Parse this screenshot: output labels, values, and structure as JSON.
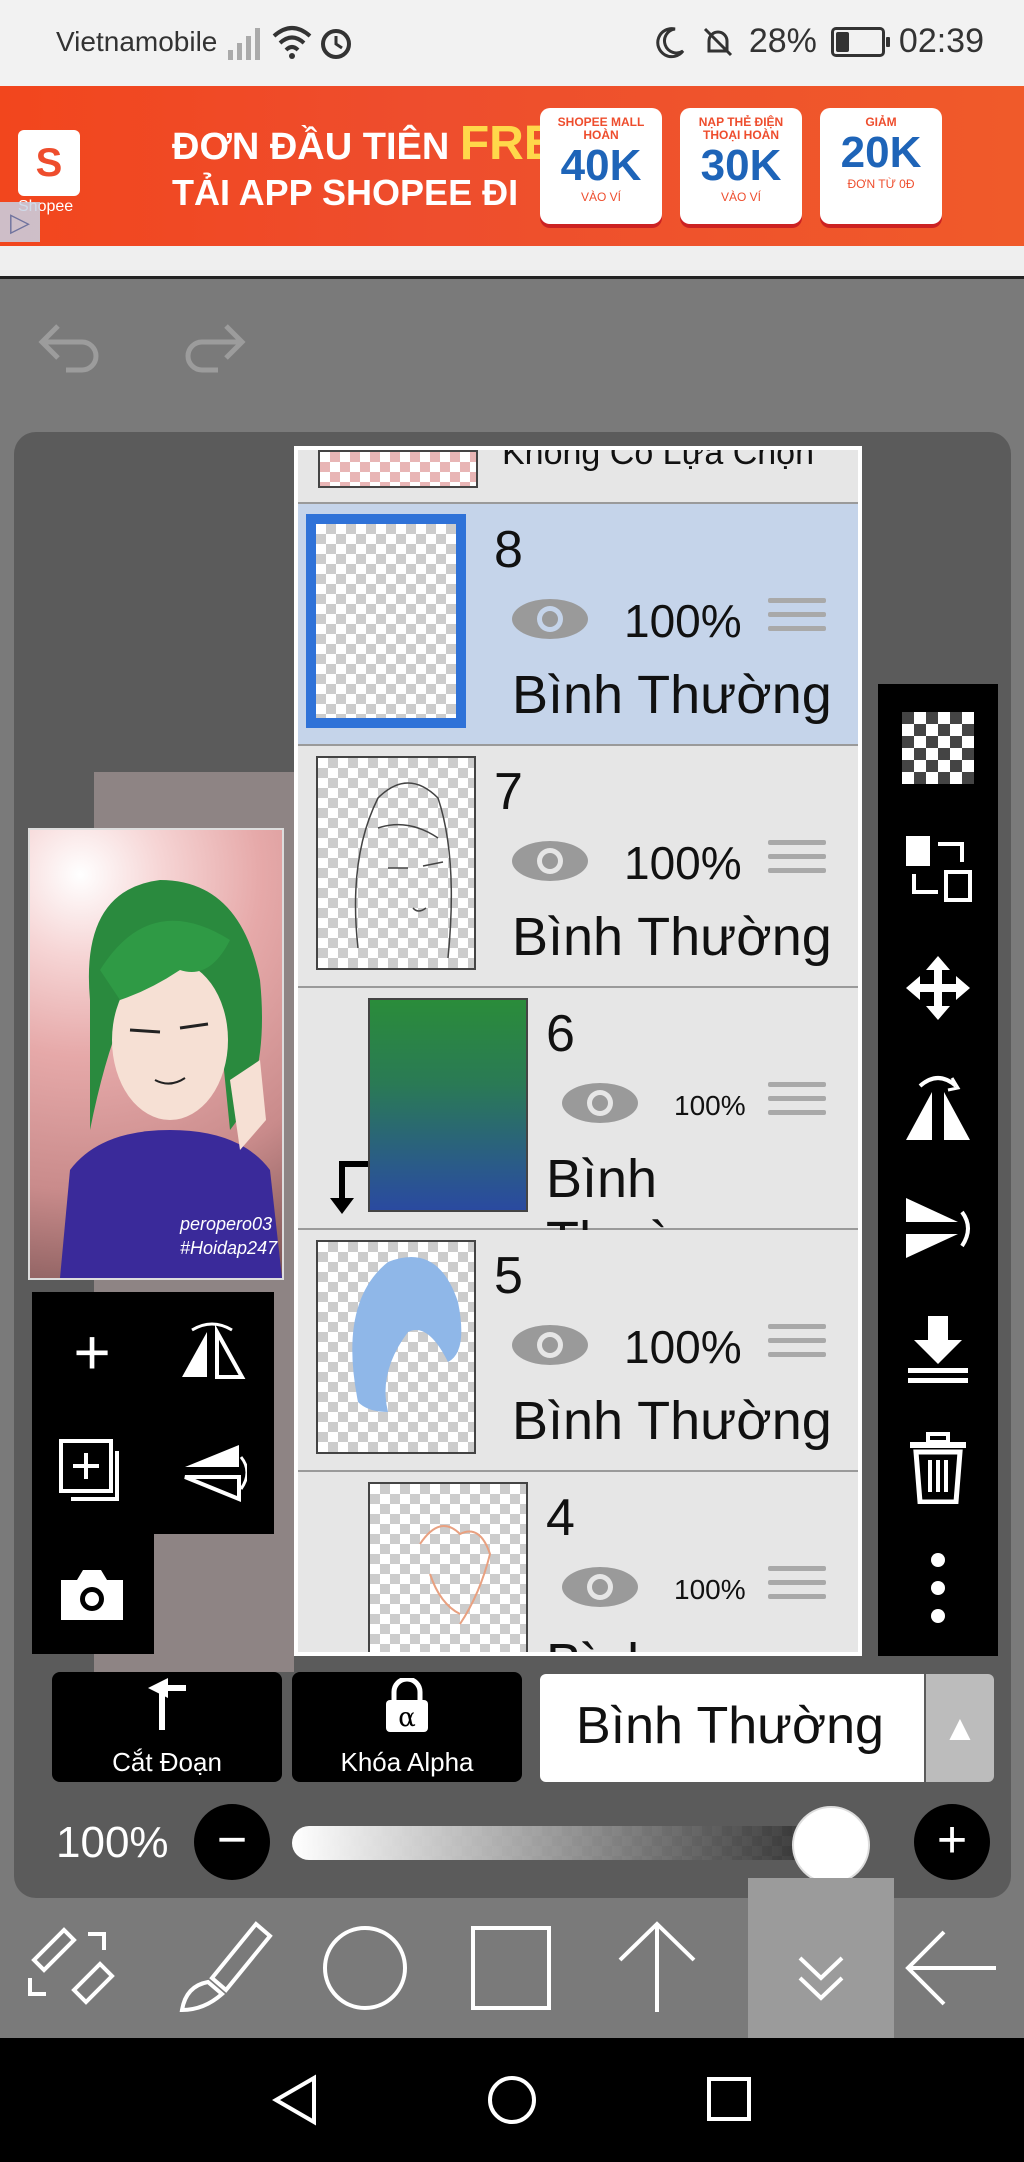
{
  "status_bar": {
    "carrier": "Vietnamobile",
    "battery": "28%",
    "time": "02:39"
  },
  "ad": {
    "brand": "Shopee",
    "line1_prefix": "ĐƠN ĐẦU TIÊN ",
    "line1_free": "FREE",
    "line2": "TẢI APP SHOPEE ĐI",
    "coupons": [
      {
        "top": "SHOPEE MALL HOÀN",
        "value": "40K",
        "bottom": "VÀO VÍ"
      },
      {
        "top": "NẠP THẺ ĐIỆN THOẠI HOÀN",
        "value": "30K",
        "bottom": "VÀO VÍ"
      },
      {
        "top": "GIẢM",
        "value": "20K",
        "bottom": "ĐƠN TỪ 0Đ"
      }
    ]
  },
  "layers": {
    "top_partial_label": "Không Có Lựa Chọn",
    "items": [
      {
        "num": "8",
        "opacity": "100%",
        "mode": "Bình Thường",
        "selected": true
      },
      {
        "num": "7",
        "opacity": "100%",
        "mode": "Bình Thường",
        "selected": false
      },
      {
        "num": "6",
        "opacity": "100%",
        "mode": "Bình Thường",
        "clipped": true
      },
      {
        "num": "5",
        "opacity": "100%",
        "mode": "Bình Thường",
        "selected": false
      },
      {
        "num": "4",
        "opacity": "100%",
        "mode": "Bình Thường",
        "clipped": true
      }
    ]
  },
  "preview": {
    "signature_1": "peropero03",
    "signature_2": "#Hoidap247"
  },
  "controls": {
    "clip_label": "Cắt Đoạn",
    "alpha_lock_label": "Khóa Alpha",
    "blend_mode": "Bình Thường",
    "opacity": "100%",
    "opacity_fraction": 1.0
  },
  "icons": {
    "undo": "undo-icon",
    "redo": "redo-icon",
    "right_toolbar": [
      "transparent-grid-icon",
      "swap-layer-icon",
      "move-icon",
      "flip-horizontal-icon",
      "flip-vertical-icon",
      "merge-down-icon",
      "trash-icon",
      "more-vertical-icon"
    ],
    "left_toolbox": [
      "add-layer-icon",
      "flip-horizontal-icon",
      "duplicate-layer-icon",
      "flip-vertical-icon",
      "camera-icon"
    ],
    "main_toolbar": [
      "transform-icon",
      "brush-icon",
      "circle-icon",
      "square-icon",
      "arrow-up-icon",
      "chevron-down-icon",
      "arrow-left-icon"
    ]
  }
}
